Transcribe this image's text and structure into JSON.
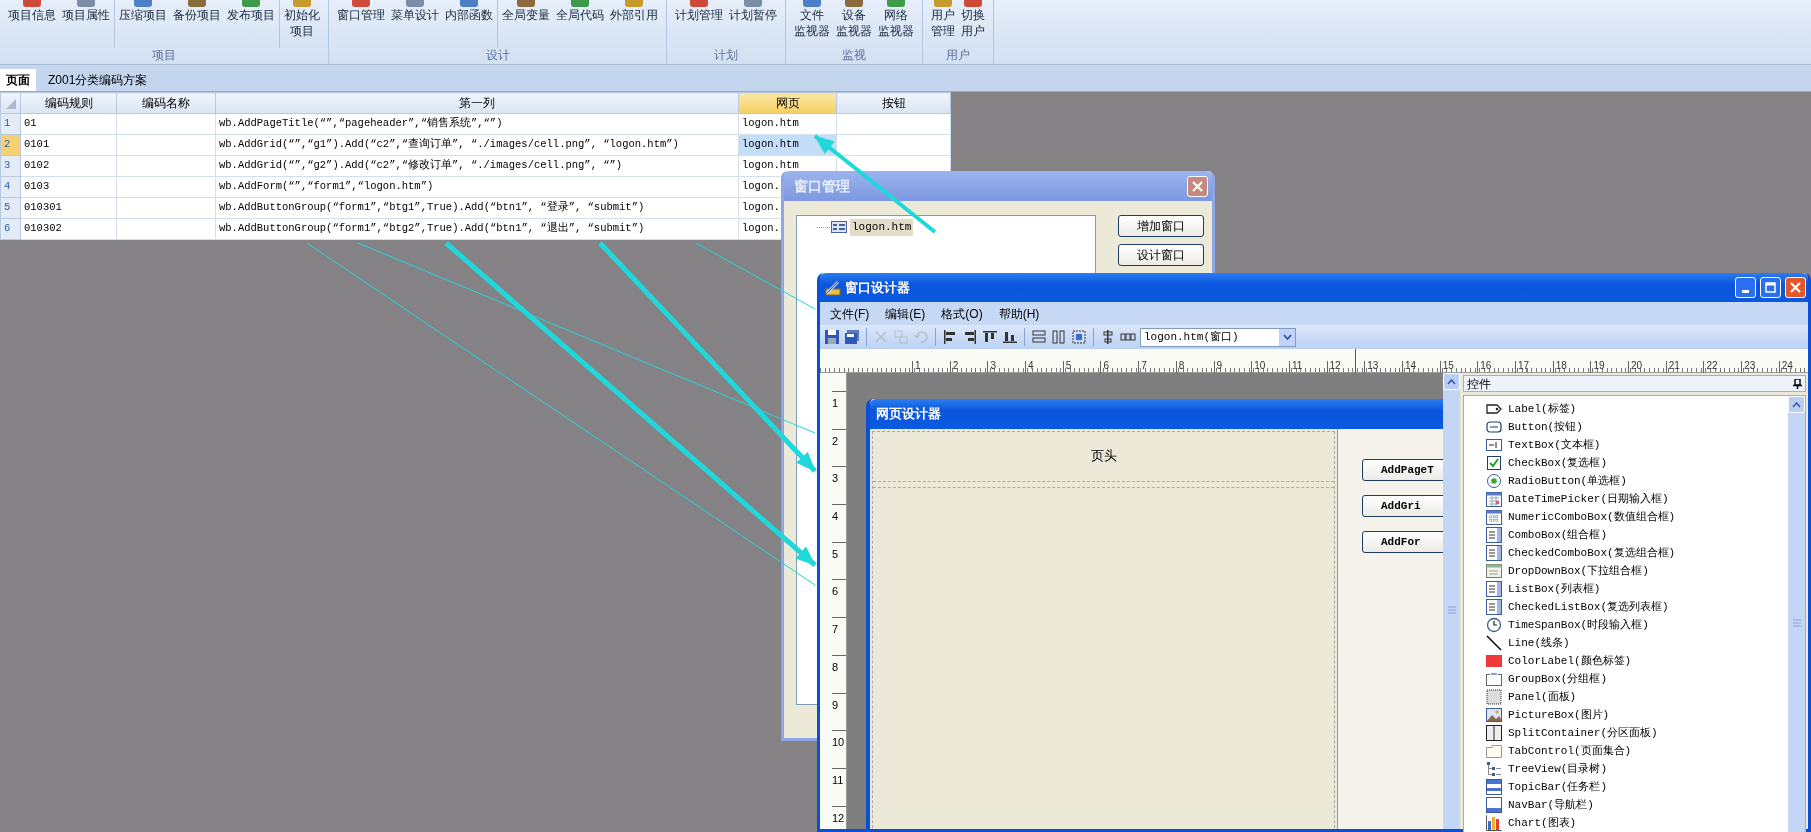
{
  "ribbon": {
    "groups": [
      {
        "label": "项目",
        "sections": [
          [
            {
              "lines": [
                "项目信息"
              ]
            },
            {
              "lines": [
                "项目属性"
              ]
            }
          ],
          [
            {
              "lines": [
                "压缩项目"
              ]
            },
            {
              "lines": [
                "备份项目"
              ]
            },
            {
              "lines": [
                "发布项目"
              ]
            }
          ],
          [
            {
              "lines": [
                "初始化",
                "项目"
              ]
            }
          ]
        ]
      },
      {
        "label": "设计",
        "sections": [
          [
            {
              "lines": [
                "窗口管理"
              ]
            },
            {
              "lines": [
                "菜单设计"
              ]
            },
            {
              "lines": [
                "内部函数"
              ]
            }
          ],
          [
            {
              "lines": [
                "全局变量"
              ]
            },
            {
              "lines": [
                "全局代码"
              ]
            },
            {
              "lines": [
                "外部引用"
              ]
            }
          ]
        ]
      },
      {
        "label": "计划",
        "sections": [
          [
            {
              "lines": [
                "计划管理"
              ]
            },
            {
              "lines": [
                "计划暂停"
              ]
            }
          ]
        ]
      },
      {
        "label": "监视",
        "sections": [
          [
            {
              "lines": [
                "文件",
                "监视器"
              ]
            },
            {
              "lines": [
                "设备",
                "监视器"
              ]
            },
            {
              "lines": [
                "网络",
                "监视器"
              ]
            }
          ]
        ]
      },
      {
        "label": "用户",
        "sections": [
          [
            {
              "lines": [
                "用户",
                "管理"
              ]
            },
            {
              "lines": [
                "切换",
                "用户"
              ]
            }
          ]
        ]
      }
    ]
  },
  "doc_tabs": [
    {
      "label": "页面",
      "selected": true
    },
    {
      "label": "Z001分类编码方案",
      "selected": false
    }
  ],
  "table": {
    "columns": [
      {
        "label": "编码规则",
        "selected": false
      },
      {
        "label": "编码名称",
        "selected": false
      },
      {
        "label": "第一列",
        "selected": false
      },
      {
        "label": "网页",
        "selected": true
      },
      {
        "label": "按钮",
        "selected": false
      }
    ],
    "rows": [
      {
        "number": "1",
        "selected": false,
        "code": "01",
        "formula": "wb.AddPageTitle(“”,“pageheader”,“销售系统”,“”)",
        "page": "logon.htm"
      },
      {
        "number": "2",
        "selected": true,
        "code": "0101",
        "formula": "wb.AddGrid(“”,“g1”).Add(“c2”,“查询订单”, “./images/cell.png”, “logon.htm”)",
        "page": "logon.htm"
      },
      {
        "number": "3",
        "selected": false,
        "code": "0102",
        "formula": "wb.AddGrid(“”,“g2”).Add(“c2”,“修改订单”, “./images/cell.png”, “”)",
        "page": "logon.htm"
      },
      {
        "number": "4",
        "selected": false,
        "code": "0103",
        "formula": "wb.AddForm(“”,“form1”,“logon.htm”)",
        "page": "logon."
      },
      {
        "number": "5",
        "selected": false,
        "code": "010301",
        "formula": "wb.AddButtonGroup(“form1”,“btg1”,True).Add(“btn1”, “登录”, “submit”)",
        "page": "logon."
      },
      {
        "number": "6",
        "selected": false,
        "code": "010302",
        "formula": "wb.AddButtonGroup(“form1”,“btg2”,True).Add(“btn1”, “退出”, “submit”)",
        "page": "logon."
      }
    ]
  },
  "window_manager": {
    "title": "窗口管理",
    "tree": [
      {
        "label": "logon.htm",
        "selected": true
      }
    ],
    "buttons": [
      "增加窗口",
      "设计窗口"
    ]
  },
  "designer": {
    "title": "窗口设计器",
    "menu": [
      "文件(F)",
      "编辑(E)",
      "格式(O)",
      "帮助(H)"
    ],
    "toolbar": [
      {
        "kind": "save",
        "disabled": false
      },
      {
        "kind": "save_all",
        "disabled": false
      },
      {
        "kind": "cut",
        "disabled": true
      },
      {
        "kind": "copy",
        "disabled": true
      },
      {
        "kind": "undo",
        "disabled": true
      },
      {
        "kind": "align_left",
        "disabled": false
      },
      {
        "kind": "align_right",
        "disabled": false
      },
      {
        "kind": "align_top",
        "disabled": false
      },
      {
        "kind": "align_bottom",
        "disabled": false
      },
      {
        "kind": "same_width",
        "disabled": false
      },
      {
        "kind": "same_height",
        "disabled": false
      },
      {
        "kind": "same_size",
        "disabled": false
      },
      {
        "kind": "center",
        "disabled": false
      },
      {
        "kind": "spacing",
        "disabled": false
      }
    ],
    "window_select": "logon.htm(窗口)",
    "ruler_h": [
      "1",
      "2",
      "3",
      "4",
      "5",
      "6",
      "7",
      "8",
      "9",
      "10",
      "11",
      "12",
      "13",
      "14",
      "15",
      "16",
      "17",
      "18",
      "19",
      "20",
      "21",
      "22",
      "23",
      "24"
    ],
    "ruler_v": [
      "1",
      "2",
      "3",
      "4",
      "5",
      "6",
      "7",
      "8",
      "9",
      "10",
      "11",
      "12"
    ],
    "page_designer": {
      "title": "网页设计器",
      "header_label": "页头",
      "buttons": [
        "AddPageT",
        "AddGri",
        "AddFor"
      ]
    },
    "controls": {
      "title": "控件",
      "items": [
        {
          "kind": "label",
          "label": "Label(标签)"
        },
        {
          "kind": "button",
          "label": "Button(按钮)"
        },
        {
          "kind": "textbox",
          "label": "TextBox(文本框)"
        },
        {
          "kind": "checkbox",
          "label": "CheckBox(复选框)"
        },
        {
          "kind": "radio",
          "label": "RadioButton(单选框)"
        },
        {
          "kind": "datetime",
          "label": "DateTimePicker(日期输入框)"
        },
        {
          "kind": "numeric",
          "label": "NumericComboBox(数值组合框)"
        },
        {
          "kind": "combo",
          "label": "ComboBox(组合框)"
        },
        {
          "kind": "checkedcombo",
          "label": "CheckedComboBox(复选组合框)"
        },
        {
          "kind": "dropdown",
          "label": "DropDownBox(下拉组合框)"
        },
        {
          "kind": "listbox",
          "label": "ListBox(列表框)"
        },
        {
          "kind": "checkedlist",
          "label": "CheckedListBox(复选列表框)"
        },
        {
          "kind": "timespan",
          "label": "TimeSpanBox(时段输入框)"
        },
        {
          "kind": "line",
          "label": "Line(线条)"
        },
        {
          "kind": "color",
          "label": "ColorLabel(颜色标签)"
        },
        {
          "kind": "groupbox",
          "label": "GroupBox(分组框)"
        },
        {
          "kind": "panel",
          "label": "Panel(面板)"
        },
        {
          "kind": "picture",
          "label": "PictureBox(图片)"
        },
        {
          "kind": "split",
          "label": "SplitContainer(分区面板)"
        },
        {
          "kind": "tab",
          "label": "TabControl(页面集合)"
        },
        {
          "kind": "tree",
          "label": "TreeView(目录树)"
        },
        {
          "kind": "topic",
          "label": "TopicBar(任务栏)"
        },
        {
          "kind": "nav",
          "label": "NavBar(导航栏)"
        },
        {
          "kind": "chart",
          "label": "Chart(图表)"
        }
      ]
    }
  }
}
